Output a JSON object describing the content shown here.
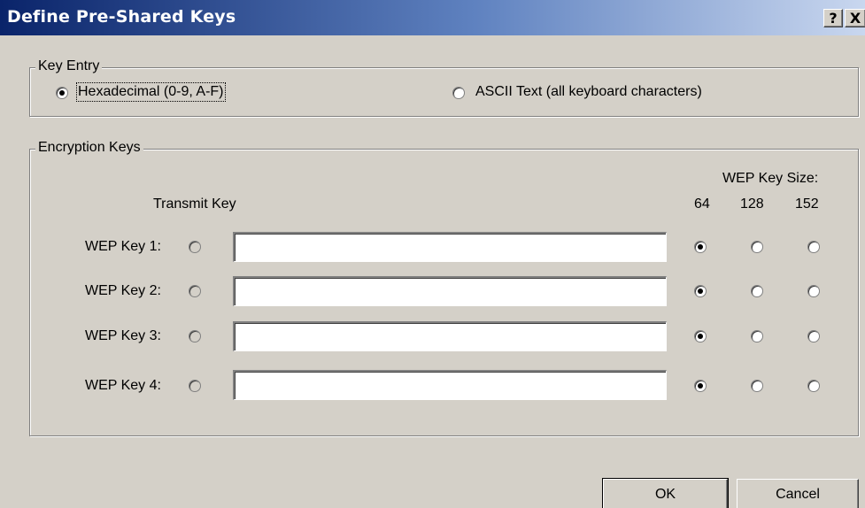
{
  "window": {
    "title": "Define Pre-Shared Keys",
    "help_label": "?",
    "close_label": "X"
  },
  "key_entry": {
    "legend": "Key Entry",
    "options": [
      {
        "label": "Hexadecimal (0-9, A-F)",
        "selected": true
      },
      {
        "label": "ASCII Text (all keyboard characters)",
        "selected": false
      }
    ]
  },
  "encryption": {
    "legend": "Encryption Keys",
    "transmit_header": "Transmit Key",
    "size_header": "WEP Key Size:",
    "sizes": [
      "64",
      "128",
      "152"
    ],
    "keys": [
      {
        "label": "WEP Key 1:",
        "value": "",
        "size": "64"
      },
      {
        "label": "WEP Key 2:",
        "value": "",
        "size": "64"
      },
      {
        "label": "WEP Key 3:",
        "value": "",
        "size": "64"
      },
      {
        "label": "WEP Key 4:",
        "value": "",
        "size": "64"
      }
    ]
  },
  "buttons": {
    "ok": "OK",
    "cancel": "Cancel"
  }
}
